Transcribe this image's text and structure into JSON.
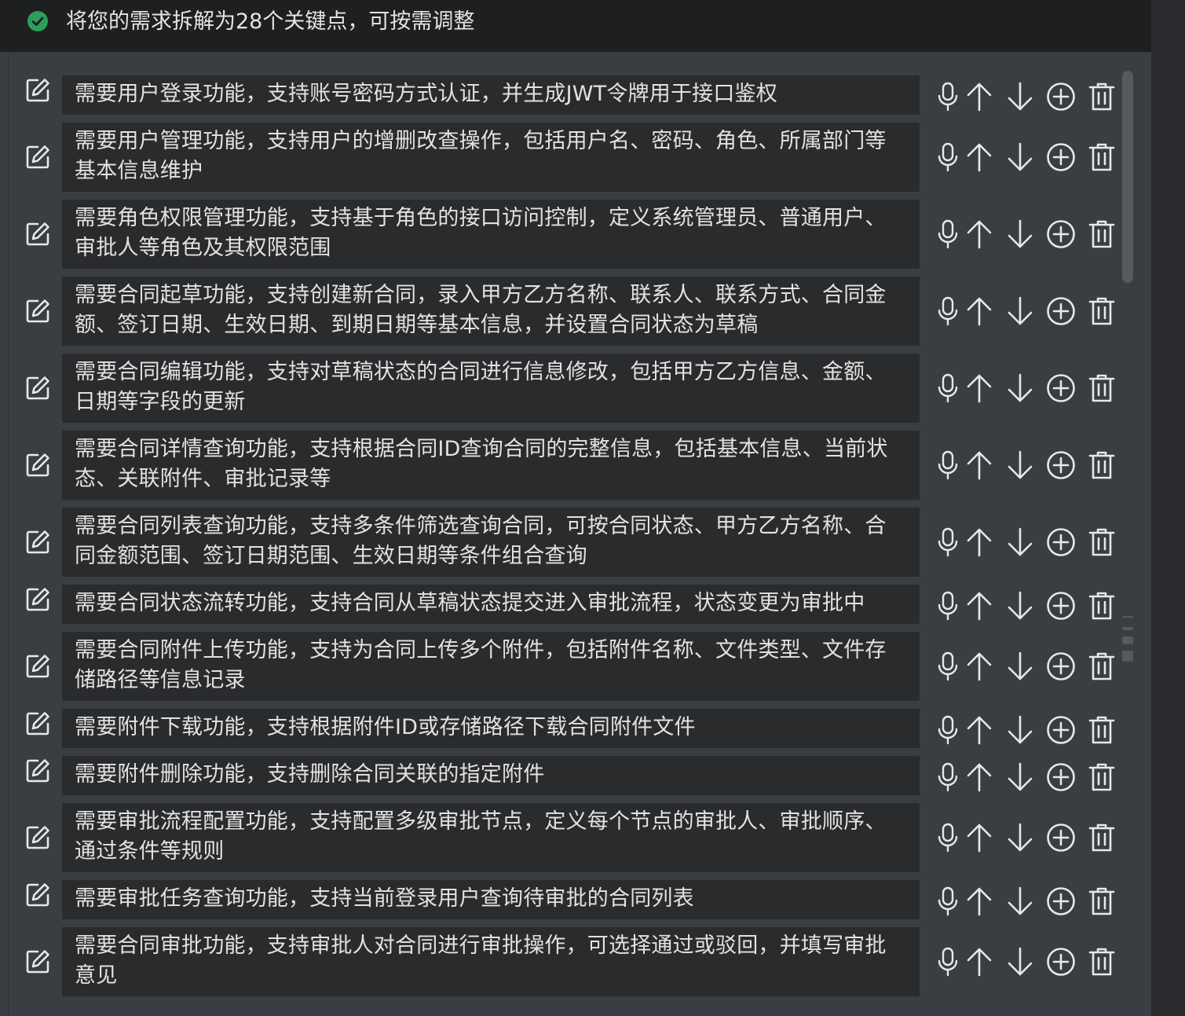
{
  "header": {
    "title": "将您的需求拆解为28个关键点，可按需调整",
    "status_icon": "check-circle-icon",
    "status_color": "#2e9e5b"
  },
  "colors": {
    "background": "#3a3d42",
    "item_background": "#2a2b2d",
    "text": "#e2e2e2",
    "icon": "#e8e8e8"
  },
  "item_actions": [
    "microphone-icon",
    "arrow-up-icon",
    "arrow-down-icon",
    "plus-circle-icon",
    "trash-icon"
  ],
  "items": [
    {
      "text": "需要用户登录功能，支持账号密码方式认证，并生成JWT令牌用于接口鉴权"
    },
    {
      "text": "需要用户管理功能，支持用户的增删改查操作，包括用户名、密码、角色、所属部门等基本信息维护"
    },
    {
      "text": "需要角色权限管理功能，支持基于角色的接口访问控制，定义系统管理员、普通用户、审批人等角色及其权限范围"
    },
    {
      "text": "需要合同起草功能，支持创建新合同，录入甲方乙方名称、联系人、联系方式、合同金额、签订日期、生效日期、到期日期等基本信息，并设置合同状态为草稿"
    },
    {
      "text": "需要合同编辑功能，支持对草稿状态的合同进行信息修改，包括甲方乙方信息、金额、日期等字段的更新"
    },
    {
      "text": "需要合同详情查询功能，支持根据合同ID查询合同的完整信息，包括基本信息、当前状态、关联附件、审批记录等"
    },
    {
      "text": "需要合同列表查询功能，支持多条件筛选查询合同，可按合同状态、甲方乙方名称、合同金额范围、签订日期范围、生效日期等条件组合查询"
    },
    {
      "text": "需要合同状态流转功能，支持合同从草稿状态提交进入审批流程，状态变更为审批中"
    },
    {
      "text": "需要合同附件上传功能，支持为合同上传多个附件，包括附件名称、文件类型、文件存储路径等信息记录"
    },
    {
      "text": "需要附件下载功能，支持根据附件ID或存储路径下载合同附件文件"
    },
    {
      "text": "需要附件删除功能，支持删除合同关联的指定附件"
    },
    {
      "text": "需要审批流程配置功能，支持配置多级审批节点，定义每个节点的审批人、审批顺序、通过条件等规则"
    },
    {
      "text": "需要审批任务查询功能，支持当前登录用户查询待审批的合同列表"
    },
    {
      "text": "需要合同审批功能，支持审批人对合同进行审批操作，可选择通过或驳回，并填写审批意见"
    }
  ]
}
